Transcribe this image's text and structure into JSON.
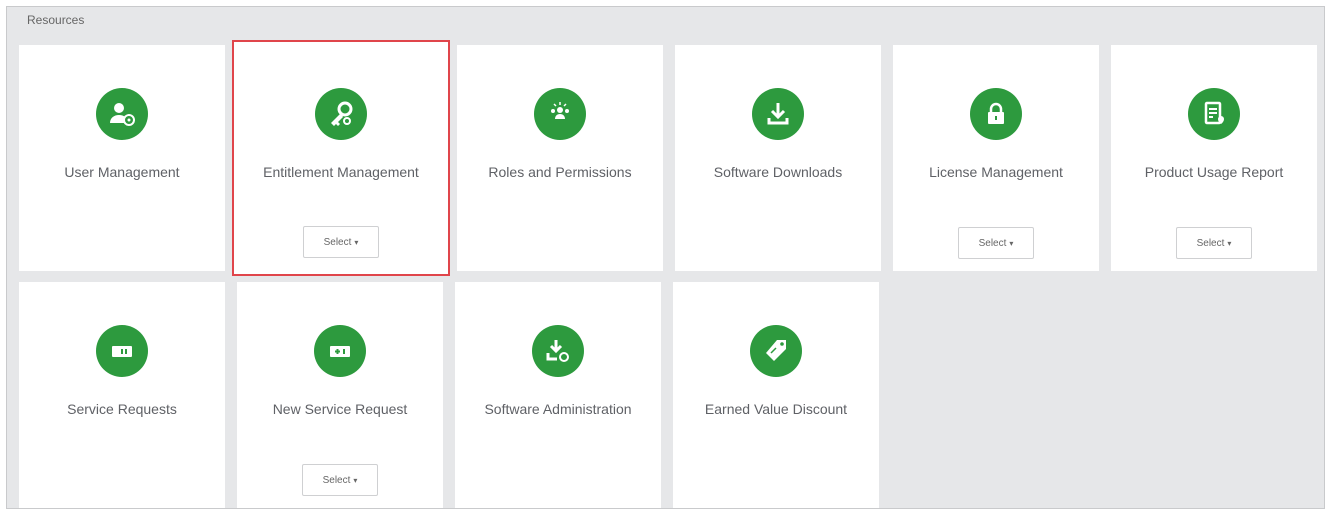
{
  "panel": {
    "title": "Resources"
  },
  "tiles": [
    {
      "label": "User Management",
      "icon": "user-settings-icon",
      "has_select": false
    },
    {
      "label": "Entitlement Management",
      "icon": "key-gear-icon",
      "has_select": true,
      "highlighted": true
    },
    {
      "label": "Roles and Permissions",
      "icon": "group-icon",
      "has_select": false
    },
    {
      "label": "Software Downloads",
      "icon": "download-icon",
      "has_select": false
    },
    {
      "label": "License Management",
      "icon": "lock-icon",
      "has_select": true
    },
    {
      "label": "Product Usage Report",
      "icon": "report-icon",
      "has_select": true
    },
    {
      "label": "Service Requests",
      "icon": "ticket-icon",
      "has_select": false
    },
    {
      "label": "New Service Request",
      "icon": "ticket-plus-icon",
      "has_select": true
    },
    {
      "label": "Software Administration",
      "icon": "download-gear-icon",
      "has_select": false
    },
    {
      "label": "Earned Value Discount",
      "icon": "price-tag-icon",
      "has_select": false
    }
  ],
  "select_label": "Select",
  "colors": {
    "accent": "#2d9a3e",
    "highlight": "#e0454b",
    "panel": "#e6e7e9"
  }
}
